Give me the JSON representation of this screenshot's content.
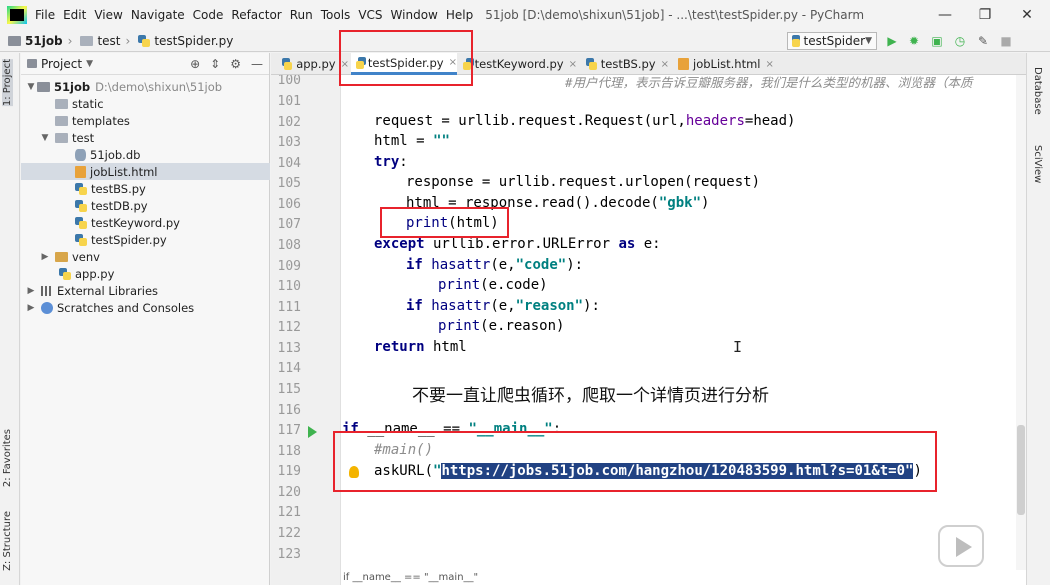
{
  "titlebar": {
    "menu": [
      "File",
      "Edit",
      "View",
      "Navigate",
      "Code",
      "Refactor",
      "Run",
      "Tools",
      "VCS",
      "Window",
      "Help"
    ],
    "title": "51job [D:\\demo\\shixun\\51job] - ...\\test\\testSpider.py - PyCharm"
  },
  "navbar": {
    "crumbs": [
      "51job",
      "test",
      "testSpider.py"
    ],
    "run_config": "testSpider"
  },
  "left_strip": {
    "project_tab": "1: Project",
    "favorites_tab": "2: Favorites",
    "structure_tab": "Z: Structure"
  },
  "right_strip": {
    "database_tab": "Database",
    "sciview_tab": "SciView"
  },
  "project": {
    "header": "Project",
    "tree": [
      {
        "label": "51job",
        "path": "D:\\demo\\shixun\\51job"
      },
      {
        "label": "static"
      },
      {
        "label": "templates"
      },
      {
        "label": "test"
      },
      {
        "label": "51job.db"
      },
      {
        "label": "jobList.html"
      },
      {
        "label": "testBS.py"
      },
      {
        "label": "testDB.py"
      },
      {
        "label": "testKeyword.py"
      },
      {
        "label": "testSpider.py"
      },
      {
        "label": "venv"
      },
      {
        "label": "app.py"
      },
      {
        "label": "External Libraries"
      },
      {
        "label": "Scratches and Consoles"
      }
    ]
  },
  "editor_tabs": [
    "app.py",
    "testSpider.py",
    "testKeyword.py",
    "testBS.py",
    "jobList.html"
  ],
  "line_numbers": [
    "100",
    "101",
    "102",
    "103",
    "104",
    "105",
    "106",
    "107",
    "108",
    "109",
    "110",
    "111",
    "112",
    "113",
    "114",
    "115",
    "116",
    "117",
    "118",
    "119",
    "120",
    "121",
    "122",
    "123"
  ],
  "code": {
    "l100": "#用户代理，表示告诉豆瓣服务器，我们是什么类型的机器、浏览器（本质",
    "l102a": "request = urllib.request.Request(url,",
    "l102b": "headers",
    "l102c": "=head)",
    "l103a": "html = ",
    "l103b": "\"\"",
    "l104": "try",
    "l105": "response = urllib.request.urlopen(request)",
    "l106a": "html = response.read().decode(",
    "l106b": "\"gbk\"",
    "l106c": ")",
    "l107a": "print",
    "l107b": "(html)",
    "l108a": "except",
    "l108b": " urllib.error.URLError ",
    "l108c": "as",
    "l108d": " e:",
    "l109a": "if",
    "l109b": "hasattr",
    "l109c": "(e,",
    "l109d": "\"code\"",
    "l109e": "):",
    "l110a": "print",
    "l110b": "(e.code)",
    "l111a": "if",
    "l111b": "hasattr",
    "l111c": "(e,",
    "l111d": "\"reason\"",
    "l111e": "):",
    "l112a": "print",
    "l112b": "(e.reason)",
    "l113a": "return",
    "l113b": " html",
    "l117a": "if",
    "l117b": " __name__ == ",
    "l117c": "\"__main__\"",
    "l117d": ":",
    "l118": "#main()",
    "l119a": "askURL(",
    "l119b": "\"",
    "l119c": "https://jobs.51job.com/hangzhou/120483599.html?s=01&t=0\"",
    "l119d": ")"
  },
  "annotation": "不要一直让爬虫循环，爬取一个详情页进行分析",
  "status_hint": "if __name__ == \"__main__\"",
  "colors": {
    "highlight_box": "#e8232c",
    "keyword": "#000080",
    "string": "#008080",
    "selection": "#214283"
  }
}
